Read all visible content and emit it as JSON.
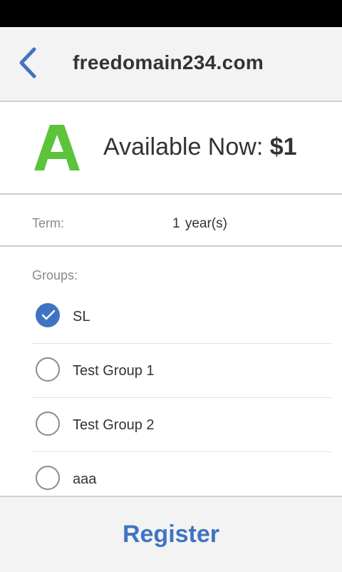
{
  "header": {
    "title": "freedomain234.com",
    "back_icon": "chevron-left-icon",
    "accent_color": "#3f74c3"
  },
  "availability": {
    "logo": "letter-a-logo",
    "logo_color": "#5cc33b",
    "label": "Available Now: ",
    "price": "$1"
  },
  "term": {
    "label": "Term:",
    "value": "1  year(s)"
  },
  "groups": {
    "label": "Groups:",
    "items": [
      {
        "name": "SL",
        "checked": true
      },
      {
        "name": "Test Group 1",
        "checked": false
      },
      {
        "name": "Test Group 2",
        "checked": false
      },
      {
        "name": "aaa",
        "checked": false
      }
    ]
  },
  "footer": {
    "register_label": "Register"
  }
}
